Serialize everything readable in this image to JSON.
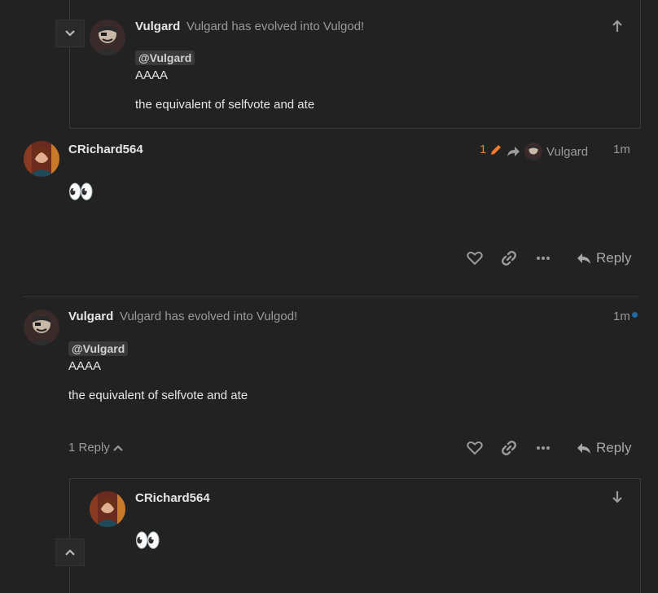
{
  "top_embed": {
    "username": "Vulgard",
    "user_title": "Vulgard has evolved into Vulgod!",
    "mention": "@Vulgard",
    "line1": "AAAA",
    "line2": "the equivalent of selfvote and ate",
    "collapse_icon": "chevron-down-icon",
    "goto_icon": "arrow-up-icon"
  },
  "post1": {
    "username": "CRichard564",
    "edit_count": "1",
    "reply_to_user": "Vulgard",
    "time": "1m",
    "body": "👀",
    "reply_label": "Reply"
  },
  "post2": {
    "username": "Vulgard",
    "user_title": "Vulgard has evolved into Vulgod!",
    "time": "1m",
    "mention": "@Vulgard",
    "line1": "AAAA",
    "line2": "the equivalent of selfvote and ate",
    "replies_label": "1 Reply",
    "reply_label": "Reply",
    "unread_dot_color": "#1a6aa6"
  },
  "bottom_embed": {
    "username": "CRichard564",
    "body": "👀",
    "goto_icon": "arrow-down-icon",
    "collapse_icon": "chevron-up-icon"
  },
  "colors": {
    "background": "#222222",
    "accent_orange": "#f27b2d",
    "muted": "#9a9a9a"
  }
}
